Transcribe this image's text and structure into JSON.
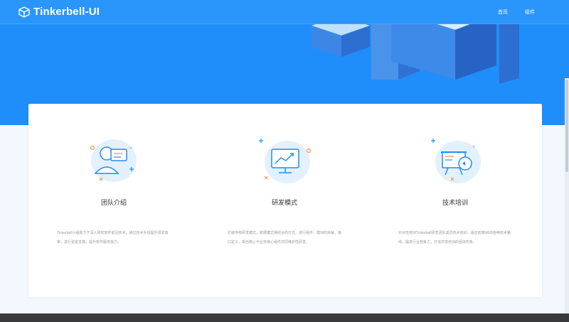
{
  "header": {
    "brand": "Tinkerbell-UI",
    "nav": [
      {
        "label": "首页"
      },
      {
        "label": "组件"
      }
    ]
  },
  "features": [
    {
      "icon": "team-icon",
      "title": "团队介绍",
      "description": "Tinkerbell小组致力于深入研究软件前沿技术，通过技术手段提升研发效率，进行资金支撑，提升软件服务能力。"
    },
    {
      "icon": "monitor-chart-icon",
      "title": "研发模式",
      "description": "打破传统研发模式，数据模式相结合的方式，进行组件、模块的拆解、接口定义，相当核心与业务核心组件共同维护性研发。"
    },
    {
      "icon": "presentation-icon",
      "title": "技术培训",
      "description": "针对性培训Tinkerbell研发团队成员技术培训，适应前端WEB各种技术路线，提高行业竞争力，打造共享培训的团体形象。"
    }
  ],
  "colors": {
    "primary": "#1f8efa",
    "header": "#2a96fb",
    "footer": "#3a3a3c"
  }
}
